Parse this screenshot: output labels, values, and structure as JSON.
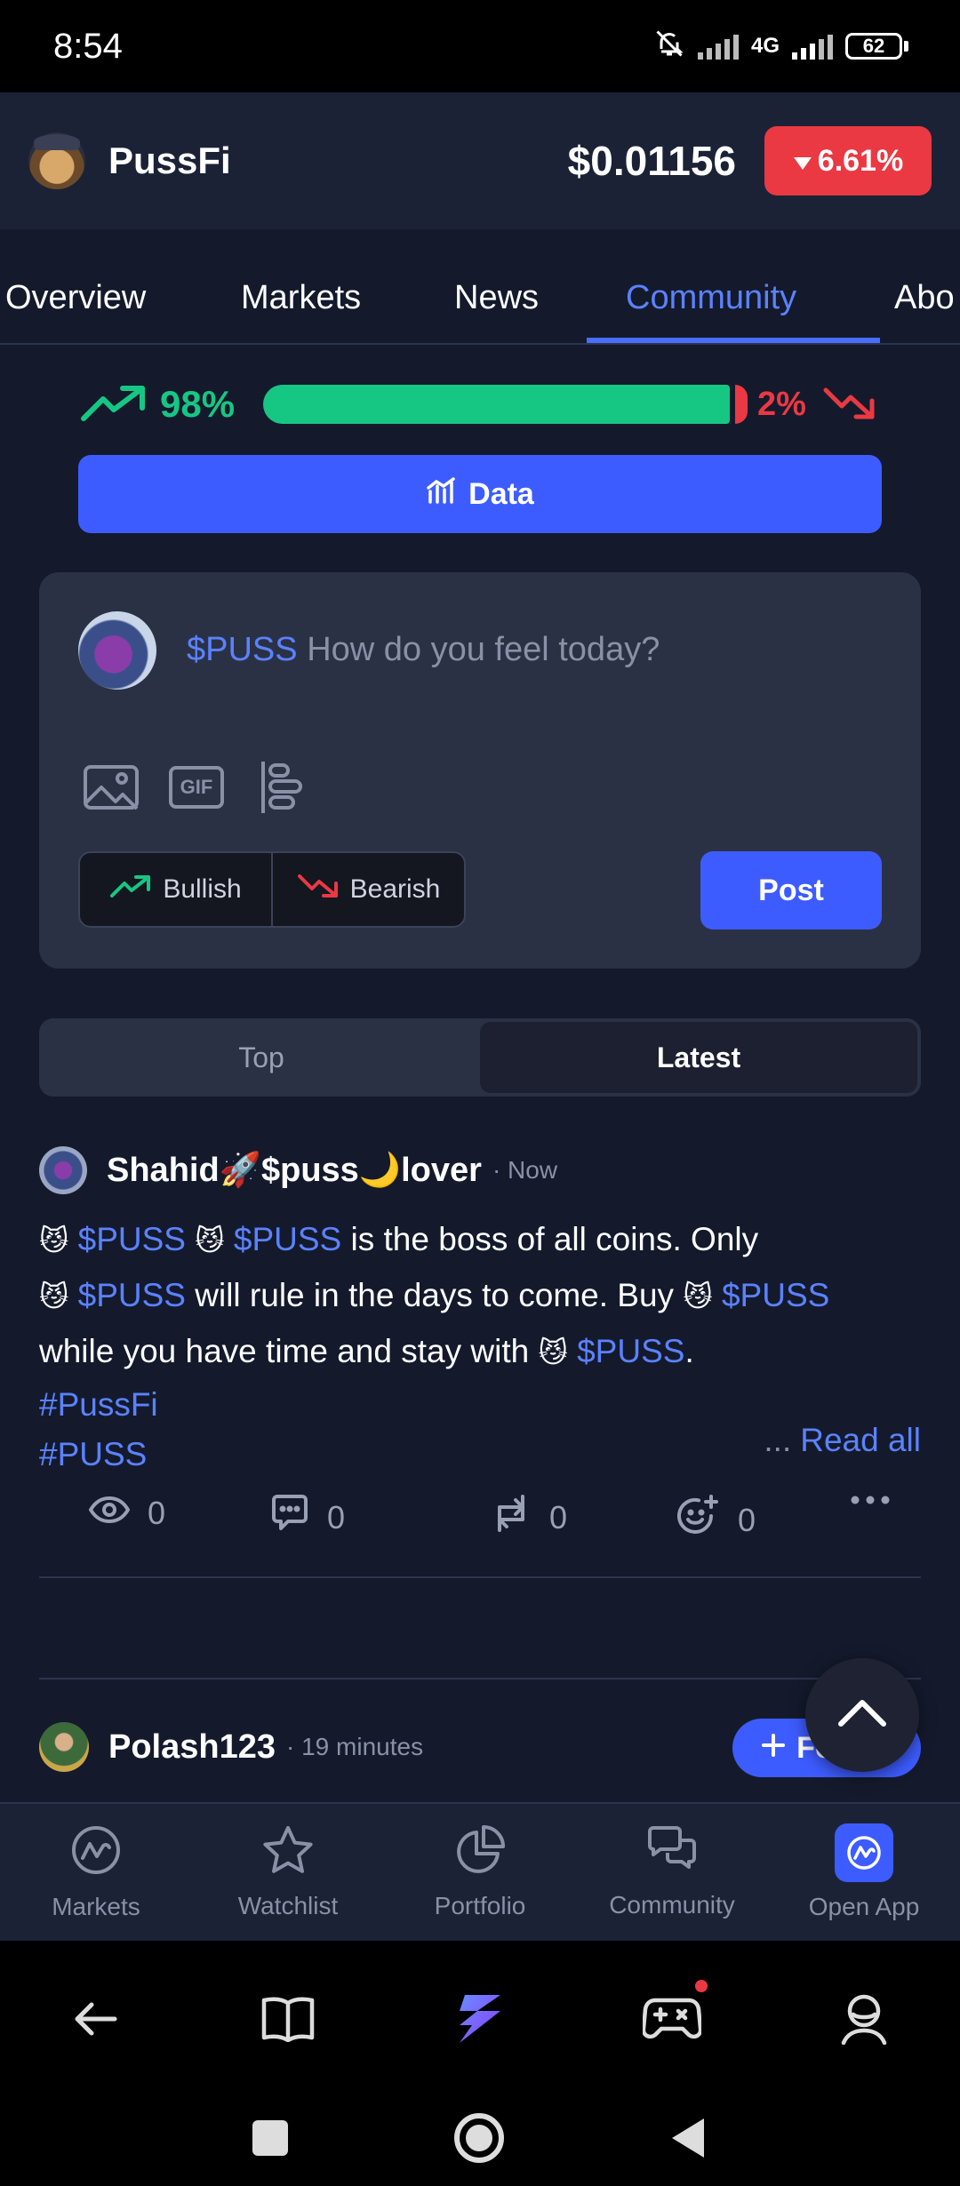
{
  "status_bar": {
    "time": "8:54",
    "network": "4G",
    "battery": "62"
  },
  "header": {
    "coin_name": "PussFi",
    "price": "$0.01156",
    "change": "6.61%",
    "change_direction": "down"
  },
  "tabs": [
    {
      "label": "Overview",
      "active": false
    },
    {
      "label": "Markets",
      "active": false
    },
    {
      "label": "News",
      "active": false
    },
    {
      "label": "Community",
      "active": true
    },
    {
      "label": "Abo",
      "active": false
    }
  ],
  "sentiment": {
    "bullish_pct": "98%",
    "bearish_pct": "2%",
    "bullish_fraction": 0.98
  },
  "data_button": {
    "label": "Data"
  },
  "composer": {
    "ticker": "$PUSS",
    "placeholder": "How do you feel today?",
    "bullish_label": "Bullish",
    "bearish_label": "Bearish",
    "post_label": "Post",
    "gif_label": "GIF"
  },
  "sort": {
    "top": "Top",
    "latest": "Latest",
    "active": "Latest"
  },
  "post1": {
    "author": "Shahid🚀$puss🌙lover",
    "time": "· Now",
    "ticker": "$PUSS",
    "t1": "is the boss of all coins. Only",
    "t2": "will rule in the days to come. Buy",
    "t3": "while you have time and stay with",
    "t4": ".",
    "hashtag1": "#PussFi",
    "hashtag2": "#PUSS",
    "read_dots": "...",
    "read_all": "Read all",
    "views": "0",
    "comments": "0",
    "reposts": "0",
    "reactions": "0"
  },
  "post2": {
    "author": "Polash123",
    "time": "· 19 minutes",
    "follow_label": "Follow"
  },
  "bottom_nav": [
    {
      "label": "Markets"
    },
    {
      "label": "Watchlist"
    },
    {
      "label": "Portfolio"
    },
    {
      "label": "Community"
    },
    {
      "label": "Open App"
    }
  ],
  "colors": {
    "bull": "#16c784",
    "bear": "#ea3943",
    "accent": "#3d5cff",
    "background": "#141a2c"
  }
}
